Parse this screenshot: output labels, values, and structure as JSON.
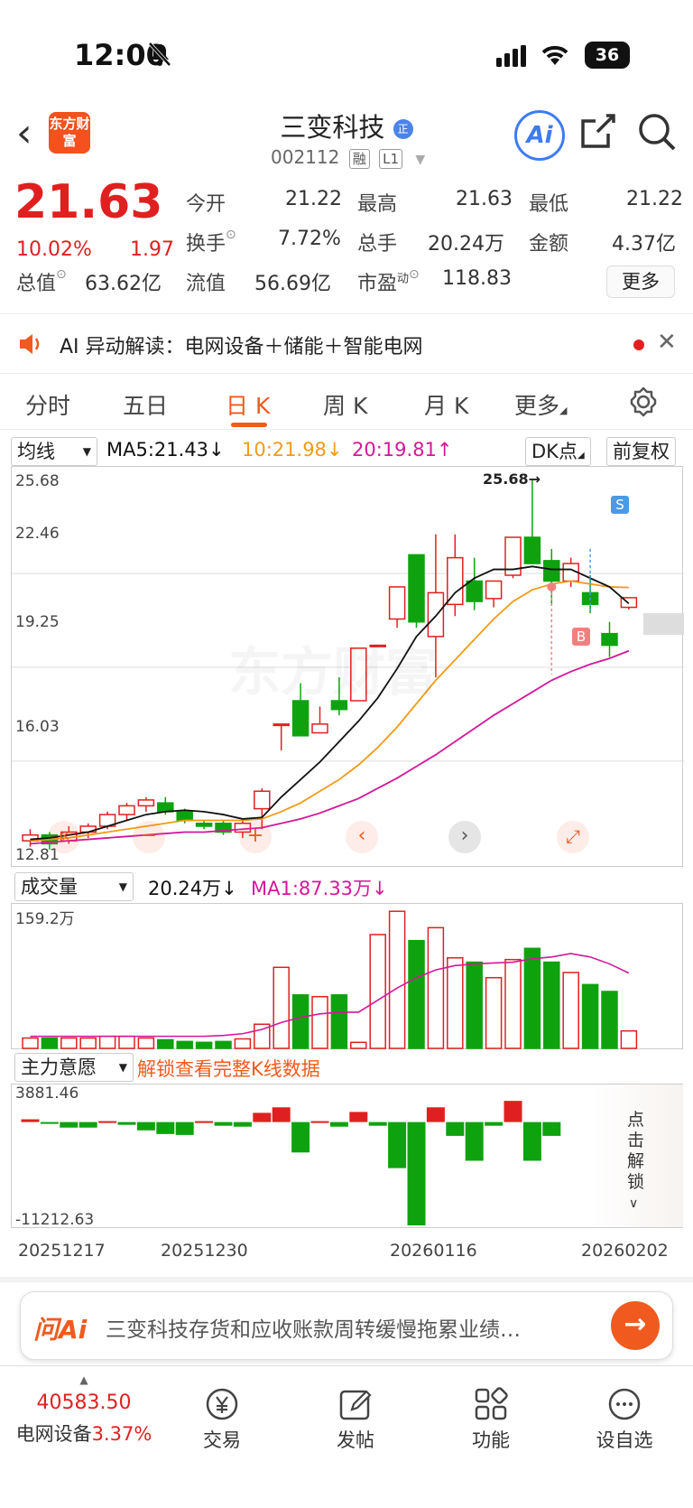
{
  "status_bar": {
    "time": "12:00",
    "battery": "36"
  },
  "header": {
    "logo_text": "东方财富",
    "title": "三变科技",
    "title_badge": "正",
    "code": "002112",
    "tags": [
      "融",
      "L1"
    ],
    "ai_label": "Ai"
  },
  "quote": {
    "price": "21.63",
    "change_pct": "10.02%",
    "change": "1.97",
    "fields": [
      {
        "label": "今开",
        "value": "21.22"
      },
      {
        "label": "最高",
        "value": "21.63"
      },
      {
        "label": "最低",
        "value": "21.22"
      },
      {
        "label": "换手",
        "value": "7.72%"
      },
      {
        "label": "总手",
        "value": "20.24万"
      },
      {
        "label": "金额",
        "value": "4.37亿"
      },
      {
        "label": "总值",
        "value": "63.62亿"
      },
      {
        "label": "流值",
        "value": "56.69亿"
      },
      {
        "label": "市盈",
        "sup": "动",
        "value": "118.83"
      }
    ],
    "more_label": "更多"
  },
  "banner": {
    "text": "AI 异动解读：电网设备＋储能＋智能电网"
  },
  "tabs": [
    "分时",
    "五日",
    "日 K",
    "周 K",
    "月 K",
    "更多"
  ],
  "active_tab": 2,
  "kline": {
    "indicator_select": "均线",
    "ma5": "MA5:21.43↓",
    "ma10": "10:21.98↓",
    "ma20": "20:19.81↑",
    "dk_button": "DK点",
    "fq_button": "前复权",
    "y_labels": [
      "25.68",
      "22.46",
      "19.25",
      "16.03",
      "12.81"
    ],
    "high_marker": "25.68→",
    "s_marker": "S",
    "b_marker": "B",
    "watermark": "东方财富"
  },
  "volume": {
    "select": "成交量",
    "current": "20.24万↓",
    "ma1": "MA1:87.33万↓",
    "max_label": "159.2万"
  },
  "flow": {
    "select": "主力意愿",
    "unlock_text": "解锁查看完整K线数据",
    "max_label": "3881.46",
    "min_label": "-11212.63",
    "side_text": "点击解锁"
  },
  "dates": [
    "20251217",
    "20251230",
    "20260116",
    "20260202"
  ],
  "chart_data": {
    "type": "candlestick",
    "candles": [
      {
        "o": 13.3,
        "c": 13.5,
        "h": 13.7,
        "l": 13.1
      },
      {
        "o": 13.5,
        "c": 13.2,
        "h": 13.6,
        "l": 13.0
      },
      {
        "o": 13.3,
        "c": 13.6,
        "h": 13.8,
        "l": 13.2
      },
      {
        "o": 13.6,
        "c": 13.8,
        "h": 13.9,
        "l": 13.4
      },
      {
        "o": 13.8,
        "c": 14.2,
        "h": 14.3,
        "l": 13.7
      },
      {
        "o": 14.2,
        "c": 14.5,
        "h": 14.6,
        "l": 14.0
      },
      {
        "o": 14.5,
        "c": 14.7,
        "h": 14.8,
        "l": 14.3
      },
      {
        "o": 14.6,
        "c": 14.3,
        "h": 14.8,
        "l": 14.2
      },
      {
        "o": 14.3,
        "c": 14.0,
        "h": 14.4,
        "l": 13.9
      },
      {
        "o": 13.9,
        "c": 13.8,
        "h": 14.0,
        "l": 13.7
      },
      {
        "o": 13.9,
        "c": 13.6,
        "h": 14.0,
        "l": 13.5
      },
      {
        "o": 13.6,
        "c": 13.9,
        "h": 14.0,
        "l": 13.4
      },
      {
        "o": 14.4,
        "c": 15.0,
        "h": 15.1,
        "l": 13.7
      },
      {
        "o": 17.3,
        "c": 17.3,
        "h": 17.3,
        "l": 16.4
      },
      {
        "o": 18.1,
        "c": 16.9,
        "h": 18.7,
        "l": 16.9
      },
      {
        "o": 17.0,
        "c": 17.3,
        "h": 17.9,
        "l": 17.0
      },
      {
        "o": 18.1,
        "c": 17.8,
        "h": 18.9,
        "l": 17.6
      },
      {
        "o": 18.1,
        "c": 19.9,
        "h": 19.9,
        "l": 18.1
      },
      {
        "o": 20.0,
        "c": 20.0,
        "h": 20.0,
        "l": 20.0
      },
      {
        "o": 20.9,
        "c": 22.0,
        "h": 22.0,
        "l": 20.6
      },
      {
        "o": 23.1,
        "c": 20.8,
        "h": 23.1,
        "l": 20.6
      },
      {
        "o": 20.3,
        "c": 21.8,
        "h": 23.8,
        "l": 18.9
      },
      {
        "o": 21.4,
        "c": 23.0,
        "h": 23.8,
        "l": 21.0
      },
      {
        "o": 22.2,
        "c": 21.5,
        "h": 23.0,
        "l": 21.2
      },
      {
        "o": 21.6,
        "c": 22.2,
        "h": 22.2,
        "l": 21.3
      },
      {
        "o": 22.4,
        "c": 23.7,
        "h": 23.7,
        "l": 22.3
      },
      {
        "o": 23.7,
        "c": 22.8,
        "h": 25.68,
        "l": 22.8
      },
      {
        "o": 22.9,
        "c": 22.2,
        "h": 23.3,
        "l": 21.4
      },
      {
        "o": 22.2,
        "c": 22.8,
        "h": 23.0,
        "l": 22.0
      },
      {
        "o": 21.8,
        "c": 21.4,
        "h": 22.4,
        "l": 21.1
      },
      {
        "o": 20.4,
        "c": 20.0,
        "h": 20.8,
        "l": 19.6
      },
      {
        "o": 21.3,
        "c": 21.63,
        "h": 21.63,
        "l": 21.22
      }
    ],
    "ma5": [
      13.35,
      13.4,
      13.5,
      13.6,
      13.8,
      14.0,
      14.2,
      14.3,
      14.35,
      14.3,
      14.2,
      14.05,
      14.1,
      14.8,
      15.4,
      16.0,
      16.7,
      17.4,
      18.2,
      19.2,
      20.3,
      21.0,
      21.8,
      22.3,
      22.6,
      22.6,
      22.7,
      22.6,
      22.6,
      22.3,
      22.0,
      21.43
    ],
    "ma10": [
      13.3,
      13.35,
      13.4,
      13.5,
      13.6,
      13.7,
      13.8,
      13.9,
      14.0,
      14.0,
      14.0,
      14.0,
      14.05,
      14.3,
      14.6,
      15.0,
      15.4,
      15.9,
      16.5,
      17.2,
      18.0,
      18.8,
      19.5,
      20.2,
      20.9,
      21.5,
      21.9,
      22.1,
      22.2,
      22.1,
      22.0,
      21.98
    ],
    "ma20": [
      13.2,
      13.25,
      13.3,
      13.35,
      13.4,
      13.45,
      13.5,
      13.55,
      13.6,
      13.6,
      13.65,
      13.7,
      13.75,
      13.9,
      14.05,
      14.25,
      14.5,
      14.75,
      15.1,
      15.45,
      15.85,
      16.25,
      16.7,
      17.15,
      17.6,
      18.0,
      18.4,
      18.8,
      19.1,
      19.35,
      19.55,
      19.81
    ],
    "volume": [
      12,
      12,
      12,
      12,
      14,
      14,
      12,
      10,
      8,
      7,
      8,
      11,
      28,
      94,
      62,
      60,
      62,
      7,
      132,
      159,
      125,
      140,
      105,
      100,
      82,
      103,
      116,
      100,
      88,
      74,
      66,
      20.24
    ],
    "volume_ma": [
      14,
      14,
      14,
      14,
      14,
      14,
      14,
      14,
      14,
      14,
      15,
      17,
      22,
      30,
      36,
      40,
      42,
      42,
      56,
      70,
      82,
      91,
      96,
      98,
      99,
      100,
      104,
      106,
      110,
      106,
      98,
      87.33
    ],
    "flow": [
      300,
      -100,
      -600,
      -600,
      100,
      -300,
      -900,
      -1300,
      -1400,
      100,
      -400,
      -500,
      1000,
      1600,
      -3300,
      100,
      -500,
      1100,
      -400,
      -5000,
      -11212,
      1600,
      -1500,
      -4200,
      -400,
      2300,
      -4200,
      -1500,
      0,
      0,
      0,
      0
    ],
    "y_axis": {
      "min": 12.81,
      "max": 25.68
    },
    "x_ticks": [
      "20251217",
      "20251230",
      "20260116",
      "20260202"
    ]
  },
  "ask_bar": {
    "brand": "问Ai",
    "text": "三变科技存货和应收账款周转缓慢拖累业绩…"
  },
  "bottom_bar": {
    "index_value": "40583.50",
    "index_name": "电网设备",
    "index_change": "3.37%",
    "items": [
      "交易",
      "发帖",
      "功能",
      "设自选"
    ]
  }
}
